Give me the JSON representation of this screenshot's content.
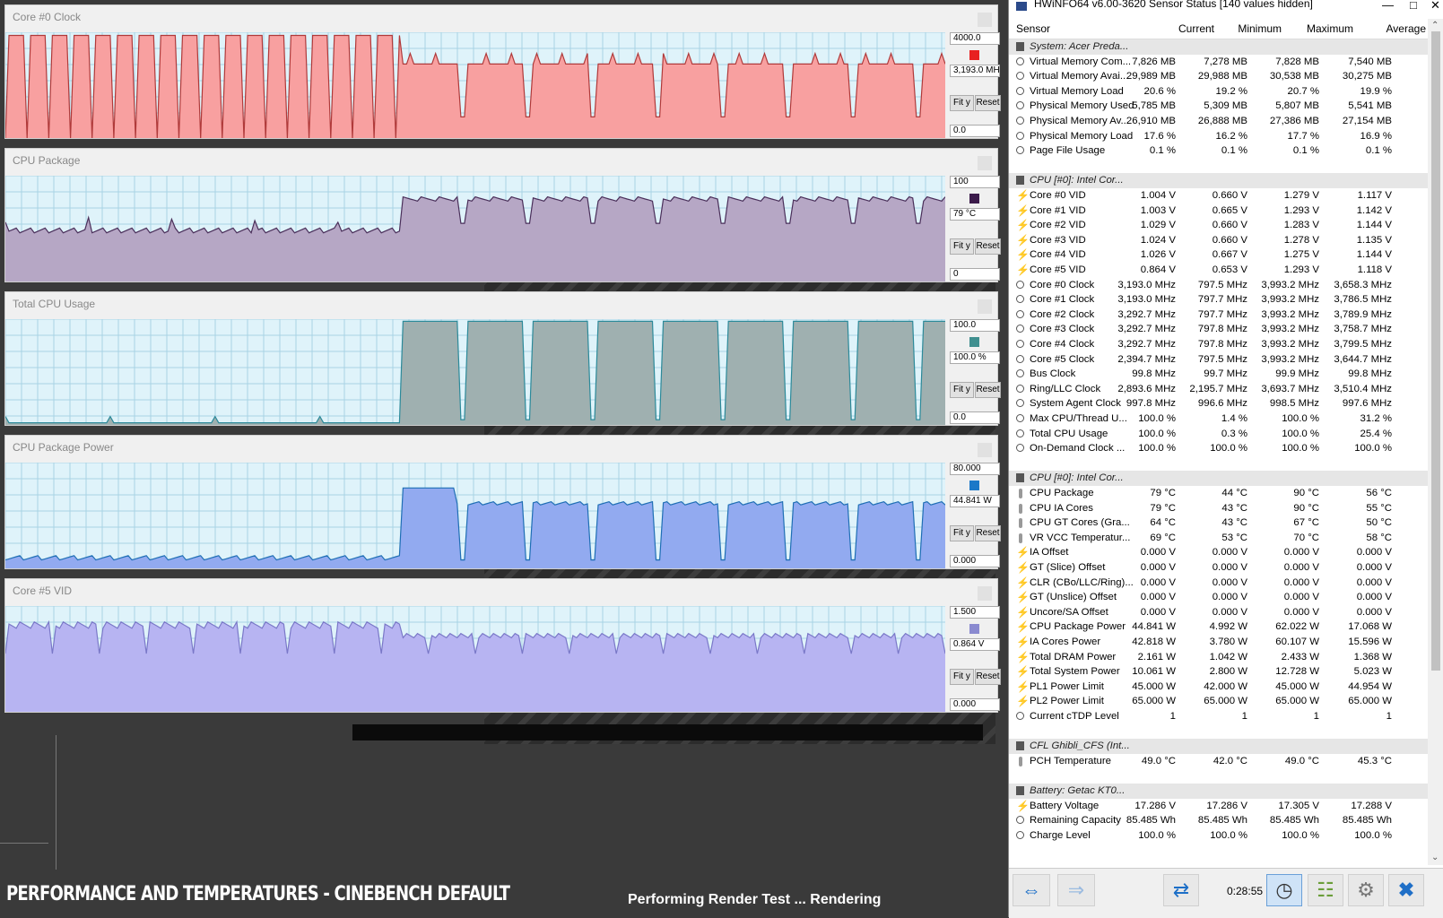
{
  "panels": [
    {
      "title": "Core #0 Clock",
      "max": "4000.0",
      "current": "3,193.0 MH:",
      "min": "0.0",
      "color": "#e82020",
      "fill": "#f8a0a0",
      "line": "#b03a3a",
      "fit": "Fit y",
      "reset": "Reset"
    },
    {
      "title": "CPU Package",
      "max": "100",
      "current": "79 °C",
      "min": "0",
      "color": "#3b1a4a",
      "fill": "#b6a7c5",
      "line": "#4a2f5a",
      "fit": "Fit y",
      "reset": "Reset"
    },
    {
      "title": "Total CPU Usage",
      "max": "100.0",
      "current": "100.0 %",
      "min": "0.0",
      "color": "#3f8f8f",
      "fill": "#9fb0b0",
      "line": "#2c8a9a",
      "fit": "Fit y",
      "reset": "Reset"
    },
    {
      "title": "CPU Package Power",
      "max": "80.000",
      "current": "44.841 W",
      "min": "0.000",
      "color": "#1b78c8",
      "fill": "#92aaf0",
      "line": "#1f6fb5",
      "fit": "Fit y",
      "reset": "Reset"
    },
    {
      "title": "Core #5 VID",
      "max": "1.500",
      "current": "0.864 V",
      "min": "0.000",
      "color": "#8a8ad0",
      "fill": "#b7b4f2",
      "line": "#7a78c8",
      "fit": "Fit y",
      "reset": "Reset"
    }
  ],
  "captions": {
    "left": "PERFORMANCE AND TEMPERATURES - CINEBENCH DEFAULT",
    "right": "Performing Render Test ... Rendering"
  },
  "hwinfo": {
    "title": "HWiNFO64 v6.00-3620 Sensor Status [140 values hidden]",
    "columns": [
      "Sensor",
      "Current",
      "Minimum",
      "Maximum",
      "Average"
    ],
    "timer": "0:28:55",
    "rows": [
      {
        "t": "group",
        "name": "System: Acer Preda..."
      },
      {
        "t": "clock",
        "name": "Virtual Memory Com...",
        "v": [
          "7,826 MB",
          "7,278 MB",
          "7,828 MB",
          "7,540 MB"
        ]
      },
      {
        "t": "clock",
        "name": "Virtual Memory Avai...",
        "v": [
          "29,989 MB",
          "29,988 MB",
          "30,538 MB",
          "30,275 MB"
        ]
      },
      {
        "t": "clock",
        "name": "Virtual Memory Load",
        "v": [
          "20.6 %",
          "19.2 %",
          "20.7 %",
          "19.9 %"
        ]
      },
      {
        "t": "clock",
        "name": "Physical Memory Used",
        "v": [
          "5,785 MB",
          "5,309 MB",
          "5,807 MB",
          "5,541 MB"
        ]
      },
      {
        "t": "clock",
        "name": "Physical Memory Av...",
        "v": [
          "26,910 MB",
          "26,888 MB",
          "27,386 MB",
          "27,154 MB"
        ]
      },
      {
        "t": "clock",
        "name": "Physical Memory Load",
        "v": [
          "17.6 %",
          "16.2 %",
          "17.7 %",
          "16.9 %"
        ]
      },
      {
        "t": "clock",
        "name": "Page File Usage",
        "v": [
          "0.1 %",
          "0.1 %",
          "0.1 %",
          "0.1 %"
        ]
      },
      {
        "t": "blank"
      },
      {
        "t": "group",
        "name": "CPU [#0]: Intel Cor..."
      },
      {
        "t": "volt",
        "name": "Core #0 VID",
        "v": [
          "1.004 V",
          "0.660 V",
          "1.279 V",
          "1.117 V"
        ]
      },
      {
        "t": "volt",
        "name": "Core #1 VID",
        "v": [
          "1.003 V",
          "0.665 V",
          "1.293 V",
          "1.142 V"
        ]
      },
      {
        "t": "volt",
        "name": "Core #2 VID",
        "v": [
          "1.029 V",
          "0.660 V",
          "1.283 V",
          "1.144 V"
        ]
      },
      {
        "t": "volt",
        "name": "Core #3 VID",
        "v": [
          "1.024 V",
          "0.660 V",
          "1.278 V",
          "1.135 V"
        ]
      },
      {
        "t": "volt",
        "name": "Core #4 VID",
        "v": [
          "1.026 V",
          "0.667 V",
          "1.275 V",
          "1.144 V"
        ]
      },
      {
        "t": "volt",
        "name": "Core #5 VID",
        "v": [
          "0.864 V",
          "0.653 V",
          "1.293 V",
          "1.118 V"
        ]
      },
      {
        "t": "clock",
        "name": "Core #0 Clock",
        "v": [
          "3,193.0 MHz",
          "797.5 MHz",
          "3,993.2 MHz",
          "3,658.3 MHz"
        ]
      },
      {
        "t": "clock",
        "name": "Core #1 Clock",
        "v": [
          "3,193.0 MHz",
          "797.7 MHz",
          "3,993.2 MHz",
          "3,786.5 MHz"
        ]
      },
      {
        "t": "clock",
        "name": "Core #2 Clock",
        "v": [
          "3,292.7 MHz",
          "797.7 MHz",
          "3,993.2 MHz",
          "3,789.9 MHz"
        ]
      },
      {
        "t": "clock",
        "name": "Core #3 Clock",
        "v": [
          "3,292.7 MHz",
          "797.8 MHz",
          "3,993.2 MHz",
          "3,758.7 MHz"
        ]
      },
      {
        "t": "clock",
        "name": "Core #4 Clock",
        "v": [
          "3,292.7 MHz",
          "797.8 MHz",
          "3,993.2 MHz",
          "3,799.5 MHz"
        ]
      },
      {
        "t": "clock",
        "name": "Core #5 Clock",
        "v": [
          "2,394.7 MHz",
          "797.5 MHz",
          "3,993.2 MHz",
          "3,644.7 MHz"
        ]
      },
      {
        "t": "clock",
        "name": "Bus Clock",
        "v": [
          "99.8 MHz",
          "99.7 MHz",
          "99.9 MHz",
          "99.8 MHz"
        ]
      },
      {
        "t": "clock",
        "name": "Ring/LLC Clock",
        "v": [
          "2,893.6 MHz",
          "2,195.7 MHz",
          "3,693.7 MHz",
          "3,510.4 MHz"
        ]
      },
      {
        "t": "clock",
        "name": "System Agent Clock",
        "v": [
          "997.8 MHz",
          "996.6 MHz",
          "998.5 MHz",
          "997.6 MHz"
        ]
      },
      {
        "t": "clock",
        "name": "Max CPU/Thread U...",
        "v": [
          "100.0 %",
          "1.4 %",
          "100.0 %",
          "31.2 %"
        ]
      },
      {
        "t": "clock",
        "name": "Total CPU Usage",
        "v": [
          "100.0 %",
          "0.3 %",
          "100.0 %",
          "25.4 %"
        ]
      },
      {
        "t": "clock",
        "name": "On-Demand Clock ...",
        "v": [
          "100.0 %",
          "100.0 %",
          "100.0 %",
          "100.0 %"
        ]
      },
      {
        "t": "blank"
      },
      {
        "t": "group",
        "name": "CPU [#0]: Intel Cor..."
      },
      {
        "t": "therm",
        "name": "CPU Package",
        "v": [
          "79 °C",
          "44 °C",
          "90 °C",
          "56 °C"
        ]
      },
      {
        "t": "therm",
        "name": "CPU IA Cores",
        "v": [
          "79 °C",
          "43 °C",
          "90 °C",
          "55 °C"
        ]
      },
      {
        "t": "therm",
        "name": "CPU GT Cores (Gra...",
        "v": [
          "64 °C",
          "43 °C",
          "67 °C",
          "50 °C"
        ]
      },
      {
        "t": "therm",
        "name": "VR VCC Temperatur...",
        "v": [
          "69 °C",
          "53 °C",
          "70 °C",
          "58 °C"
        ]
      },
      {
        "t": "volt",
        "name": "IA Offset",
        "v": [
          "0.000 V",
          "0.000 V",
          "0.000 V",
          "0.000 V"
        ]
      },
      {
        "t": "volt",
        "name": "GT (Slice) Offset",
        "v": [
          "0.000 V",
          "0.000 V",
          "0.000 V",
          "0.000 V"
        ]
      },
      {
        "t": "volt",
        "name": "CLR (CBo/LLC/Ring)...",
        "v": [
          "0.000 V",
          "0.000 V",
          "0.000 V",
          "0.000 V"
        ]
      },
      {
        "t": "volt",
        "name": "GT (Unslice) Offset",
        "v": [
          "0.000 V",
          "0.000 V",
          "0.000 V",
          "0.000 V"
        ]
      },
      {
        "t": "volt",
        "name": "Uncore/SA Offset",
        "v": [
          "0.000 V",
          "0.000 V",
          "0.000 V",
          "0.000 V"
        ]
      },
      {
        "t": "volt",
        "name": "CPU Package Power",
        "v": [
          "44.841 W",
          "4.992 W",
          "62.022 W",
          "17.068 W"
        ]
      },
      {
        "t": "volt",
        "name": "IA Cores Power",
        "v": [
          "42.818 W",
          "3.780 W",
          "60.107 W",
          "15.596 W"
        ]
      },
      {
        "t": "volt",
        "name": "Total DRAM Power",
        "v": [
          "2.161 W",
          "1.042 W",
          "2.433 W",
          "1.368 W"
        ]
      },
      {
        "t": "volt",
        "name": "Total System Power",
        "v": [
          "10.061 W",
          "2.800 W",
          "12.728 W",
          "5.023 W"
        ]
      },
      {
        "t": "volt",
        "name": "PL1 Power Limit",
        "v": [
          "45.000 W",
          "42.000 W",
          "45.000 W",
          "44.954 W"
        ]
      },
      {
        "t": "volt",
        "name": "PL2 Power Limit",
        "v": [
          "65.000 W",
          "65.000 W",
          "65.000 W",
          "65.000 W"
        ]
      },
      {
        "t": "clock",
        "name": "Current cTDP Level",
        "v": [
          "1",
          "1",
          "1",
          "1"
        ]
      },
      {
        "t": "blank"
      },
      {
        "t": "group",
        "name": "CFL Ghibli_CFS (Int..."
      },
      {
        "t": "therm",
        "name": "PCH Temperature",
        "v": [
          "49.0 °C",
          "42.0 °C",
          "49.0 °C",
          "45.3 °C"
        ]
      },
      {
        "t": "blank"
      },
      {
        "t": "group",
        "name": "Battery: Getac KT0..."
      },
      {
        "t": "volt",
        "name": "Battery Voltage",
        "v": [
          "17.286 V",
          "17.286 V",
          "17.305 V",
          "17.288 V"
        ]
      },
      {
        "t": "clock",
        "name": "Remaining Capacity",
        "v": [
          "85.485 Wh",
          "85.485 Wh",
          "85.485 Wh",
          "85.485 Wh"
        ]
      },
      {
        "t": "clock",
        "name": "Charge Level",
        "v": [
          "100.0 %",
          "100.0 %",
          "100.0 %",
          "100.0 %"
        ]
      }
    ]
  }
}
